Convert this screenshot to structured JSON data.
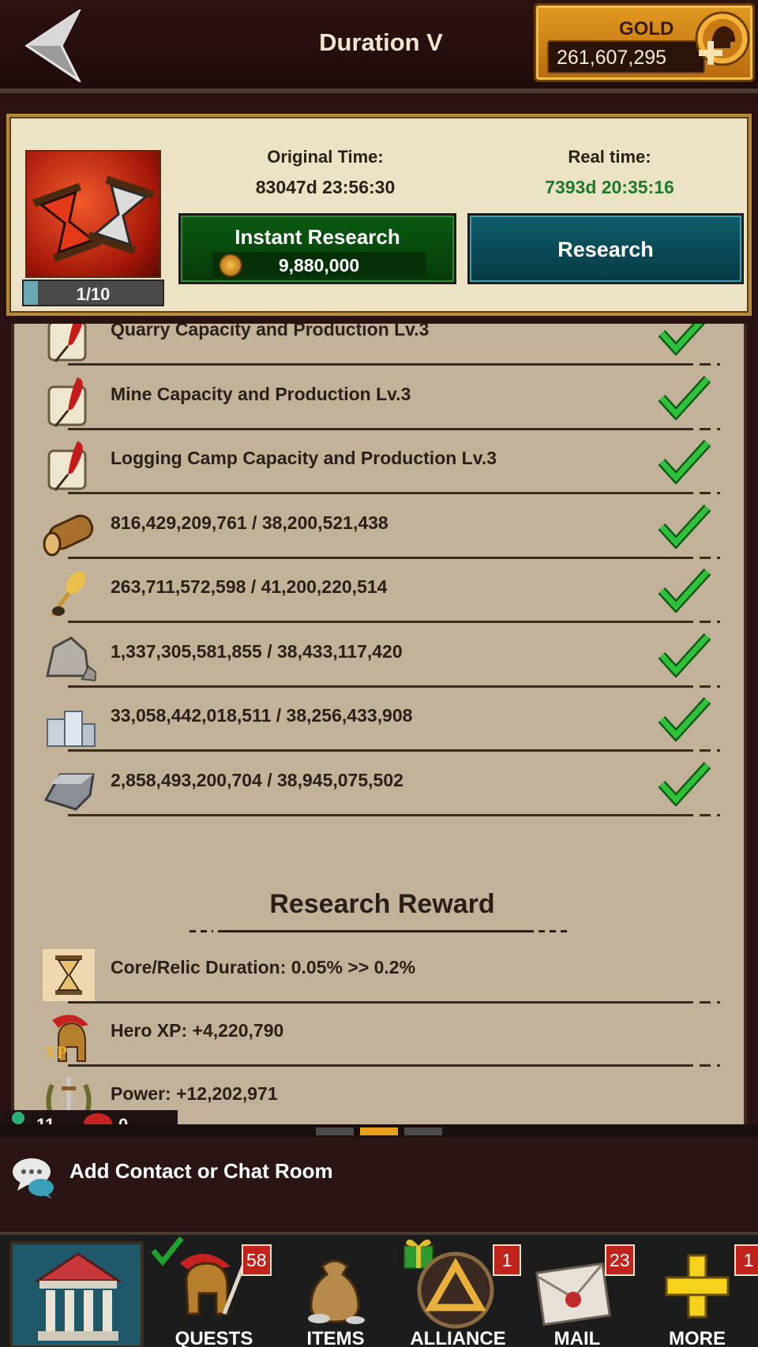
{
  "header": {
    "title": "Duration V",
    "gold_label": "GOLD",
    "gold_value": "261,607,295"
  },
  "card": {
    "level": "1/10",
    "level_progress": 0.1,
    "original_time_label": "Original Time:",
    "original_time_value": "83047d 23:56:30",
    "real_time_label": "Real time:",
    "real_time_value": "7393d 20:35:16",
    "instant_label": "Instant Research",
    "instant_cost": "9,880,000",
    "research_label": "Research"
  },
  "requirements": [
    {
      "icon": "scroll-quill-icon",
      "text": "Quarry Capacity and Production Lv.3",
      "met": true
    },
    {
      "icon": "scroll-quill-icon",
      "text": "Mine Capacity and Production Lv.3",
      "met": true
    },
    {
      "icon": "scroll-quill-icon",
      "text": "Logging Camp Capacity and Production Lv.3",
      "met": true
    },
    {
      "icon": "wood-log-icon",
      "text": "816,429,209,761 / 38,200,521,438",
      "met": true
    },
    {
      "icon": "wheat-icon",
      "text": "263,711,572,598 / 41,200,220,514",
      "met": true
    },
    {
      "icon": "stone-icon",
      "text": "1,337,305,581,855 / 38,433,117,420",
      "met": true
    },
    {
      "icon": "silver-coins-icon",
      "text": "33,058,442,018,511 / 38,256,433,908",
      "met": true
    },
    {
      "icon": "iron-ingot-icon",
      "text": "2,858,493,200,704 / 38,945,075,502",
      "met": true
    }
  ],
  "reward": {
    "heading": "Research Reward",
    "items": [
      {
        "icon": "hourglass-icon",
        "text": "Core/Relic Duration: 0.05% >> 0.2%"
      },
      {
        "icon": "hero-xp-helmet-icon",
        "text": "Hero XP: +4,220,790"
      },
      {
        "icon": "power-laurel-icon",
        "text": "Power: +12,202,971"
      }
    ]
  },
  "status": {
    "online": "11",
    "messages": "0"
  },
  "chat": {
    "label": "Add Contact or Chat Room"
  },
  "nav": [
    {
      "label": "",
      "badge": ""
    },
    {
      "label": "QUESTS",
      "badge": "58"
    },
    {
      "label": "ITEMS",
      "badge": ""
    },
    {
      "label": "ALLIANCE",
      "badge": "1"
    },
    {
      "label": "MAIL",
      "badge": "23"
    },
    {
      "label": "MORE",
      "badge": "1"
    }
  ],
  "colors": {
    "accent_gold": "#e39a20",
    "instant_green": "#0b5a12",
    "research_teal": "#0f5d6b",
    "real_time_green": "#1c7a2c",
    "check_green": "#1fa12e"
  }
}
